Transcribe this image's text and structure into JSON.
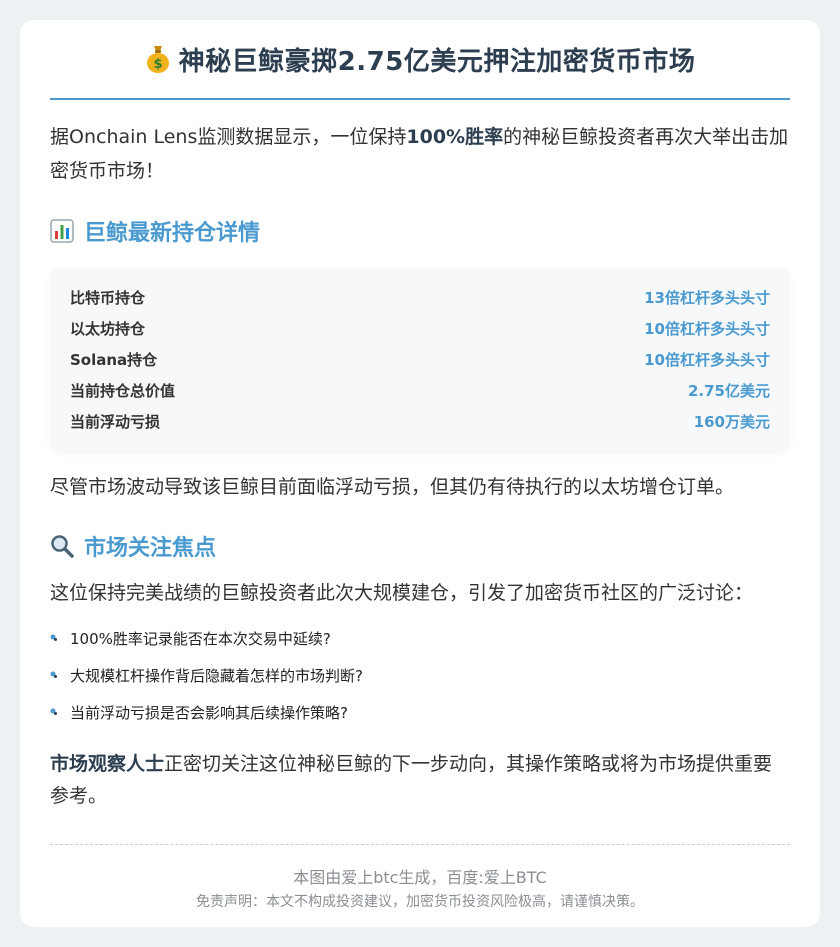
{
  "title": "神秘巨鲸豪掷2.75亿美元押注加密货币市场",
  "title_icon": "money-bag-icon",
  "intro": {
    "prefix": "据Onchain Lens监测数据显示，一位保持",
    "bold": "100%胜率",
    "suffix": "的神秘巨鲸投资者再次大举出击加密货币市场！"
  },
  "holdings_section": {
    "icon": "bar-chart-icon",
    "heading": "巨鲸最新持仓详情",
    "rows": [
      {
        "label": "比特币持仓",
        "value": "13倍杠杆多头头寸"
      },
      {
        "label": "以太坊持仓",
        "value": "10倍杠杆多头头寸"
      },
      {
        "label": "Solana持仓",
        "value": "10倍杠杆多头头寸"
      },
      {
        "label": "当前持仓总价值",
        "value": "2.75亿美元"
      },
      {
        "label": "当前浮动亏损",
        "value": "160万美元"
      }
    ]
  },
  "after_holdings": "尽管市场波动导致该巨鲸目前面临浮动亏损，但其仍有待执行的以太坊增仓订单。",
  "focus_section": {
    "icon": "magnifier-icon",
    "heading": "市场关注焦点",
    "intro": "这位保持完美战绩的巨鲸投资者此次大规模建仓，引发了加密货币社区的广泛讨论：",
    "bullets": [
      "100%胜率记录能否在本次交易中延续?",
      "大规模杠杆操作背后隐藏着怎样的市场判断?",
      "当前浮动亏损是否会影响其后续操作策略?"
    ]
  },
  "closing": {
    "bold": "市场观察人士",
    "text": "正密切关注这位神秘巨鲸的下一步动向，其操作策略或将为市场提供重要参考。"
  },
  "footer": {
    "line1": "本图由爱上btc生成，百度:爱上BTC",
    "line2": "免责声明：本文不构成投资建议，加密货币投资风险极高，请谨慎决策。"
  },
  "colors": {
    "accent": "#4a9ad0",
    "title": "#2c3e50",
    "background": "#eef1f4"
  }
}
